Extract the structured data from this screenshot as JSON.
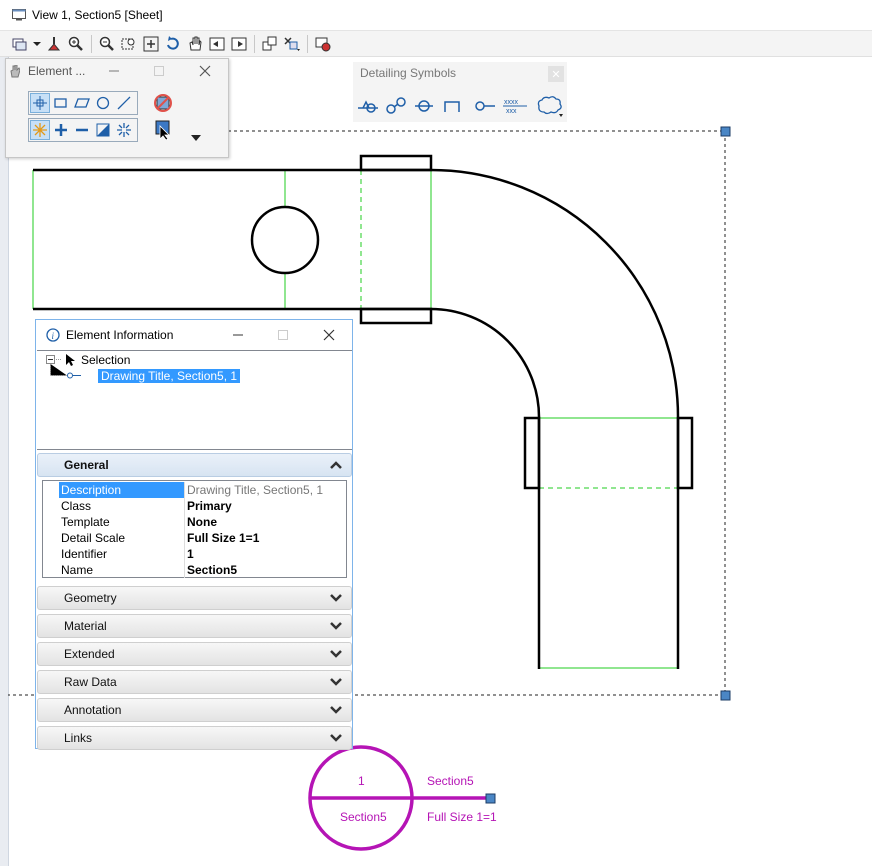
{
  "window": {
    "title": "View 1, Section5 [Sheet]"
  },
  "element_selection": {
    "title": "Element ..."
  },
  "detailing_symbols": {
    "title": "Detailing Symbols"
  },
  "element_information": {
    "title": "Element Information",
    "tree": {
      "root": "Selection",
      "child": "Drawing Title, Section5, 1"
    },
    "general": {
      "label": "General",
      "properties": [
        {
          "key": "Description",
          "value": "Drawing Title, Section5, 1"
        },
        {
          "key": "Class",
          "value": "Primary"
        },
        {
          "key": "Template",
          "value": "None"
        },
        {
          "key": "Detail Scale",
          "value": "Full Size 1=1"
        },
        {
          "key": "Identifier",
          "value": "1"
        },
        {
          "key": "Name",
          "value": "Section5"
        }
      ]
    },
    "sections": [
      "Geometry",
      "Material",
      "Extended",
      "Raw Data",
      "Annotation",
      "Links"
    ]
  },
  "drawing_title": {
    "number": "1",
    "name_in_bubble": "Section5",
    "name": "Section5",
    "scale": "Full Size 1=1"
  },
  "colors": {
    "drawing_title": "#b514b5",
    "construction_lines": "#22cc22",
    "selection": "#3399ff",
    "handle": "#4a86c5"
  }
}
